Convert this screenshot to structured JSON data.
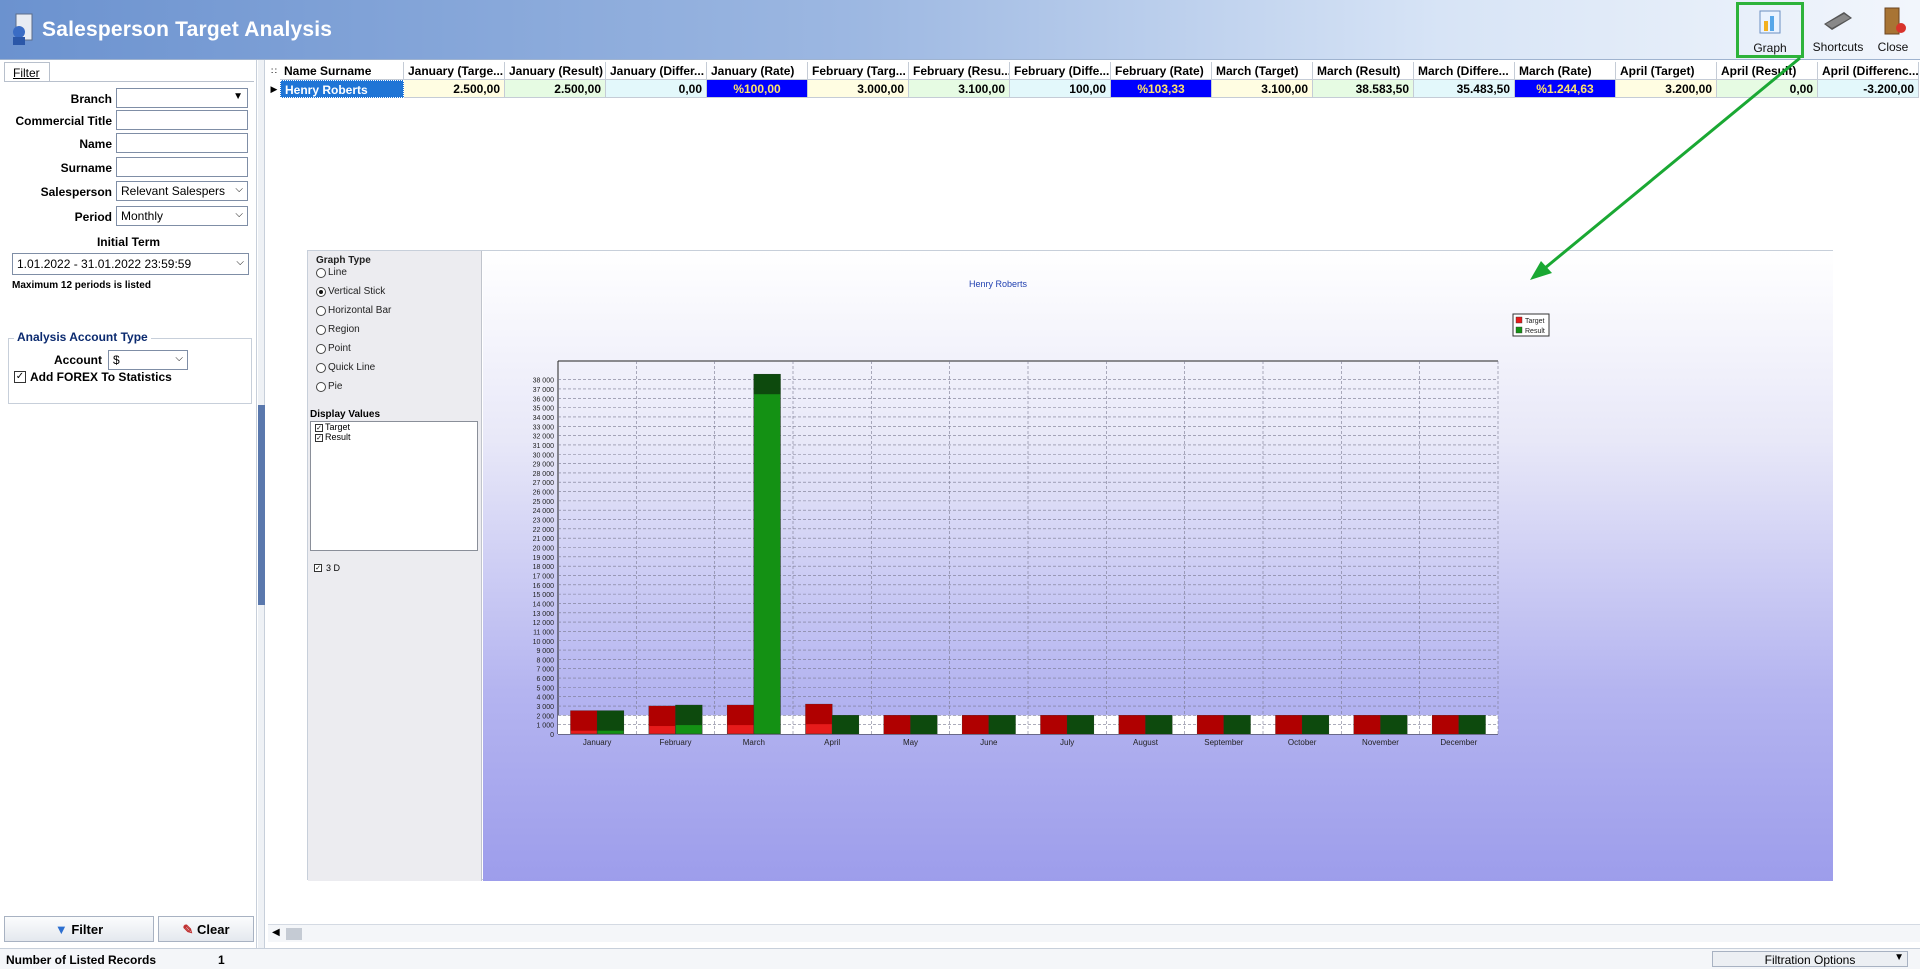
{
  "window": {
    "title": "Salesperson Target Analysis"
  },
  "toolbar": {
    "graph_label": "Graph",
    "shortcuts_label": "Shortcuts",
    "close_label": "Close"
  },
  "filter": {
    "tab_label": "Filter",
    "branch_label": "Branch",
    "branch_value": "",
    "commercial_title_label": "Commercial Title",
    "commercial_title_value": "",
    "name_label": "Name",
    "name_value": "",
    "surname_label": "Surname",
    "surname_value": "",
    "salesperson_label": "Salesperson",
    "salesperson_value": "Relevant Salespers",
    "period_label": "Period",
    "period_value": "Monthly",
    "initial_term_label": "Initial Term",
    "initial_term_value": "1.01.2022 - 31.01.2022 23:59:59",
    "max_periods_note": "Maximum 12 periods is listed",
    "analysis_title": "Analysis Account Type",
    "account_label": "Account",
    "account_value": "$",
    "forex_label": "Add FOREX To Statistics",
    "forex_checked": true,
    "filter_button": "Filter",
    "clear_button": "Clear"
  },
  "grid": {
    "columns": [
      "Name Surname",
      "January (Targe...",
      "January (Result)",
      "January (Differ...",
      "January (Rate)",
      "February (Targ...",
      "February (Resu...",
      "February (Diffe...",
      "February (Rate)",
      "March (Target)",
      "March (Result)",
      "March (Differe...",
      "March (Rate)",
      "April (Target)",
      "April (Result)",
      "April (Differenc..."
    ],
    "rows": [
      [
        "Henry Roberts",
        "2.500,00",
        "2.500,00",
        "0,00",
        "%100,00",
        "3.000,00",
        "3.100,00",
        "100,00",
        "%103,33",
        "3.100,00",
        "38.583,50",
        "35.483,50",
        "%1.244,63",
        "3.200,00",
        "0,00",
        "-3.200,00"
      ]
    ]
  },
  "graph_options": {
    "graph_type_title": "Graph Type",
    "types": [
      "Line",
      "Vertical Stick",
      "Horizontal Bar",
      "Region",
      "Point",
      "Quick Line",
      "Pie"
    ],
    "selected_type": "Vertical Stick",
    "display_values_title": "Display Values",
    "display_values": [
      "Target",
      "Result"
    ],
    "three_d_label": "3 D",
    "three_d_checked": true
  },
  "chart_data": {
    "type": "bar",
    "title": "Henry Roberts",
    "categories": [
      "January",
      "February",
      "March",
      "April",
      "May",
      "June",
      "July",
      "August",
      "September",
      "October",
      "November",
      "December"
    ],
    "series": [
      {
        "name": "Target",
        "values": [
          2500,
          3000,
          3100,
          3200,
          0,
          0,
          0,
          0,
          0,
          0,
          0,
          0
        ],
        "color": "#e61b1b"
      },
      {
        "name": "Result",
        "values": [
          2500,
          3100,
          38583.5,
          0,
          0,
          0,
          0,
          0,
          0,
          0,
          0,
          0
        ],
        "color": "#149114"
      }
    ],
    "y_ticks": [
      "0",
      "1 000",
      "2 000",
      "3 000",
      "4 000",
      "5 000",
      "6 000",
      "7 000",
      "8 000",
      "9 000",
      "10 000",
      "11 000",
      "12 000",
      "13 000",
      "14 000",
      "15 000",
      "16 000",
      "17 000",
      "18 000",
      "19 000",
      "20 000",
      "21 000",
      "22 000",
      "23 000",
      "24 000",
      "25 000",
      "26 000",
      "27 000",
      "28 000",
      "29 000",
      "30 000",
      "31 000",
      "32 000",
      "33 000",
      "34 000",
      "35 000",
      "36 000",
      "37 000",
      "38 000"
    ],
    "ylim": [
      0,
      40000
    ],
    "legend_position": "top-right",
    "grid": true
  },
  "status": {
    "records_label": "Number of Listed Records",
    "records_count": "1",
    "filtration_options": "Filtration Options"
  }
}
